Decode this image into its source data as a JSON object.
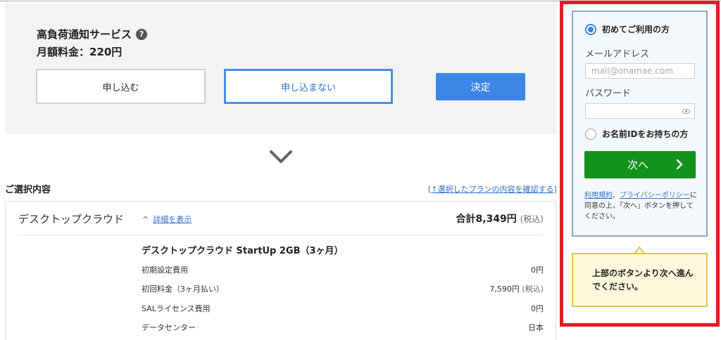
{
  "service": {
    "title": "高負荷通知サービス",
    "help_icon": "question-circle-icon",
    "price": "月額料金：220円",
    "apply_label": "申し込む",
    "decline_label": "申し込まない",
    "decide_label": "決定"
  },
  "expand_icon": "chevron-down-icon",
  "selection": {
    "heading": "ご選択内容",
    "confirm_link_open": "[",
    "confirm_link": "↑選択したプランの内容を確認する",
    "confirm_link_close": "]",
    "plan_name": "デスクトップクラウド",
    "detail_caret": "^",
    "detail_link": "詳細を表示",
    "total_label": "合計8,349円",
    "total_tax": "(税込)",
    "plan_detail_title": "デスクトップクラウド StartUp 2GB（3ヶ月）",
    "rows": [
      {
        "label": "初期設定費用",
        "value": "0円",
        "tax": ""
      },
      {
        "label": "初回料金（3ヶ月払い）",
        "value": "7,590円",
        "tax": "(税込)"
      },
      {
        "label": "SALライセンス費用",
        "value": "0円",
        "tax": ""
      },
      {
        "label": "データセンター",
        "value": "日本",
        "tax": ""
      }
    ]
  },
  "login": {
    "first_time_label": "初めてご利用の方",
    "email_label": "メールアドレス",
    "email_placeholder": "mail@onamae.com",
    "password_label": "パスワード",
    "password_icon": "eye-icon",
    "has_id_label": "お名前IDをお持ちの方",
    "next_label": "次へ",
    "terms_link": "利用規約",
    "terms_sep": "、",
    "privacy_link": "プライバシーポリシー",
    "terms_text": "に同意の上、「次へ」ボタンを押してください。",
    "tooltip": "上部のボタンより次へ進んでください。"
  },
  "colors": {
    "accent_blue": "#3d86e6",
    "next_green": "#13921e",
    "highlight_red": "#e31b23",
    "tooltip_bg": "#fdf7dc"
  }
}
